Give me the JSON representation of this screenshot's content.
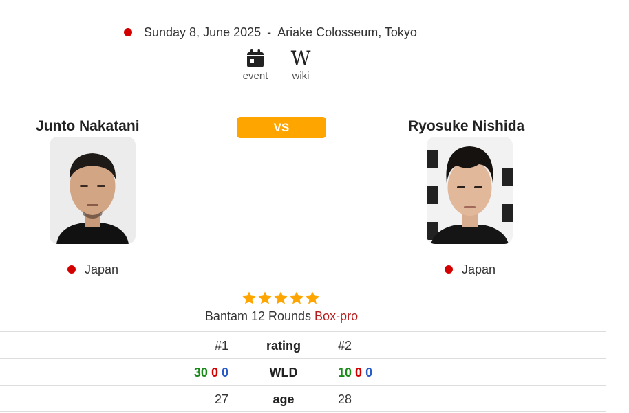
{
  "event": {
    "date": "Sunday 8, June 2025",
    "separator": "-",
    "venue": "Ariake Colosseum, Tokyo",
    "status_color": "#d40000"
  },
  "links": {
    "event_label": "event",
    "event_icon": "calendar-icon",
    "wiki_label": "wiki",
    "wiki_icon": "wikipedia-icon",
    "wiki_glyph": "W"
  },
  "vs_label": "VS",
  "fighter_left": {
    "name": "Junto Nakatani",
    "country": "Japan",
    "rank": "#1",
    "record": {
      "wins": "30",
      "losses": "0",
      "draws": "0"
    },
    "age": "27"
  },
  "fighter_right": {
    "name": "Ryosuke Nishida",
    "country": "Japan",
    "rank": "#2",
    "record": {
      "wins": "10",
      "losses": "0",
      "draws": "0"
    },
    "age": "28"
  },
  "bout": {
    "stars": 5,
    "division_rounds": "Bantam 12 Rounds",
    "sport": "Box-pro"
  },
  "stats_labels": {
    "rating": "rating",
    "wld": "WLD",
    "age": "age"
  },
  "colors": {
    "accent": "#ffa500",
    "win": "#1a8a1a",
    "loss": "#d40000",
    "draw": "#2a5cc9",
    "sport_link": "#b71c1c"
  }
}
